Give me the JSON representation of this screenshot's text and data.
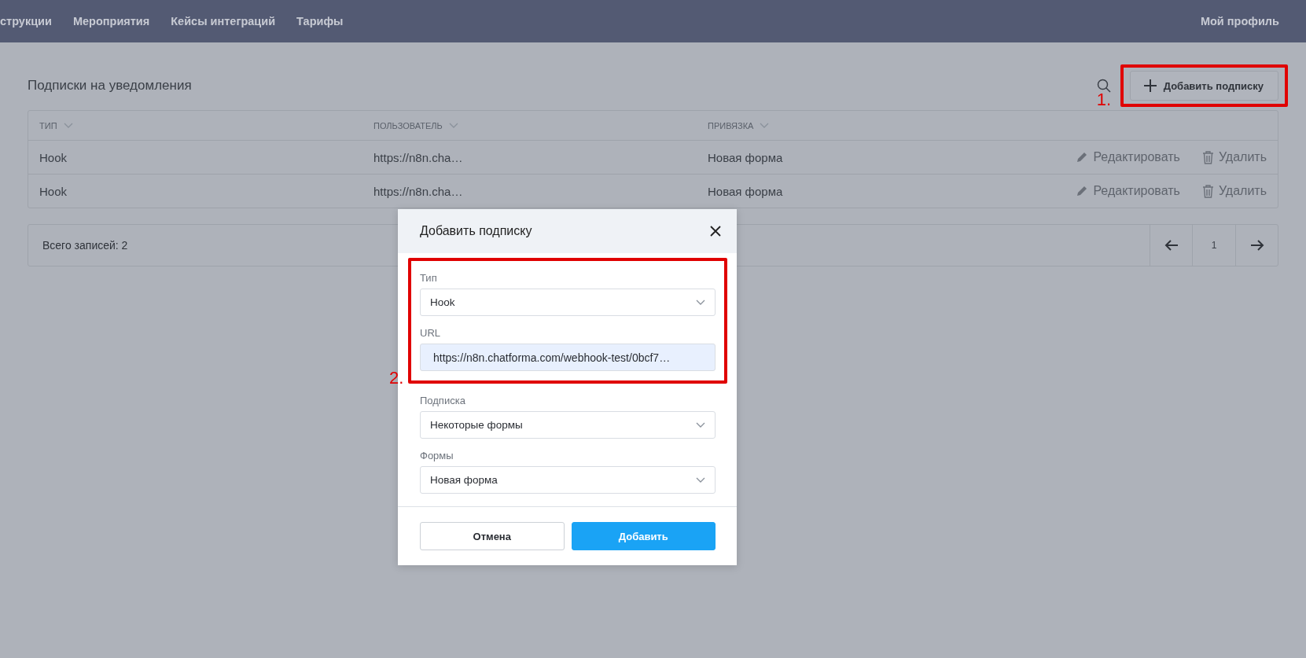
{
  "nav": {
    "items": [
      {
        "label": "струкции"
      },
      {
        "label": "Мероприятия"
      },
      {
        "label": "Кейсы интеграций"
      },
      {
        "label": "Тарифы"
      }
    ],
    "profile": "Мой профиль"
  },
  "page": {
    "title": "Подписки на уведомления",
    "add_button": "Добавить подписку"
  },
  "table": {
    "columns": [
      "ТИП",
      "ПОЛЬЗОВАТЕЛЬ",
      "ПРИВЯЗКА"
    ],
    "rows": [
      {
        "cells": [
          "Hook",
          "https://n8n.cha…",
          "Новая форма"
        ],
        "actions": [
          "Редактировать",
          "Удалить"
        ]
      },
      {
        "cells": [
          "Hook",
          "https://n8n.cha…",
          "Новая форма"
        ],
        "actions": [
          "Редактировать",
          "Удалить"
        ]
      }
    ]
  },
  "pagination": {
    "total": "Всего записей: 2",
    "page": "1"
  },
  "dialog": {
    "title": "Добавить подписку",
    "fields": [
      {
        "kind": "select",
        "label": "Тип",
        "value": "Hook",
        "framed": true
      },
      {
        "kind": "input",
        "label": "URL",
        "value": "https://n8n.chatforma.com/webhook-test/0bcf7…",
        "framed": true
      },
      {
        "kind": "select",
        "label": "Подписка",
        "value": "Некоторые формы"
      },
      {
        "kind": "select",
        "label": "Формы",
        "value": "Новая форма"
      }
    ],
    "buttons": [
      {
        "kind": "secondary",
        "label": "Отмена"
      },
      {
        "kind": "primary",
        "label": "Добавить"
      }
    ]
  },
  "annotations": [
    {
      "label": "1."
    },
    {
      "label": "2."
    }
  ]
}
